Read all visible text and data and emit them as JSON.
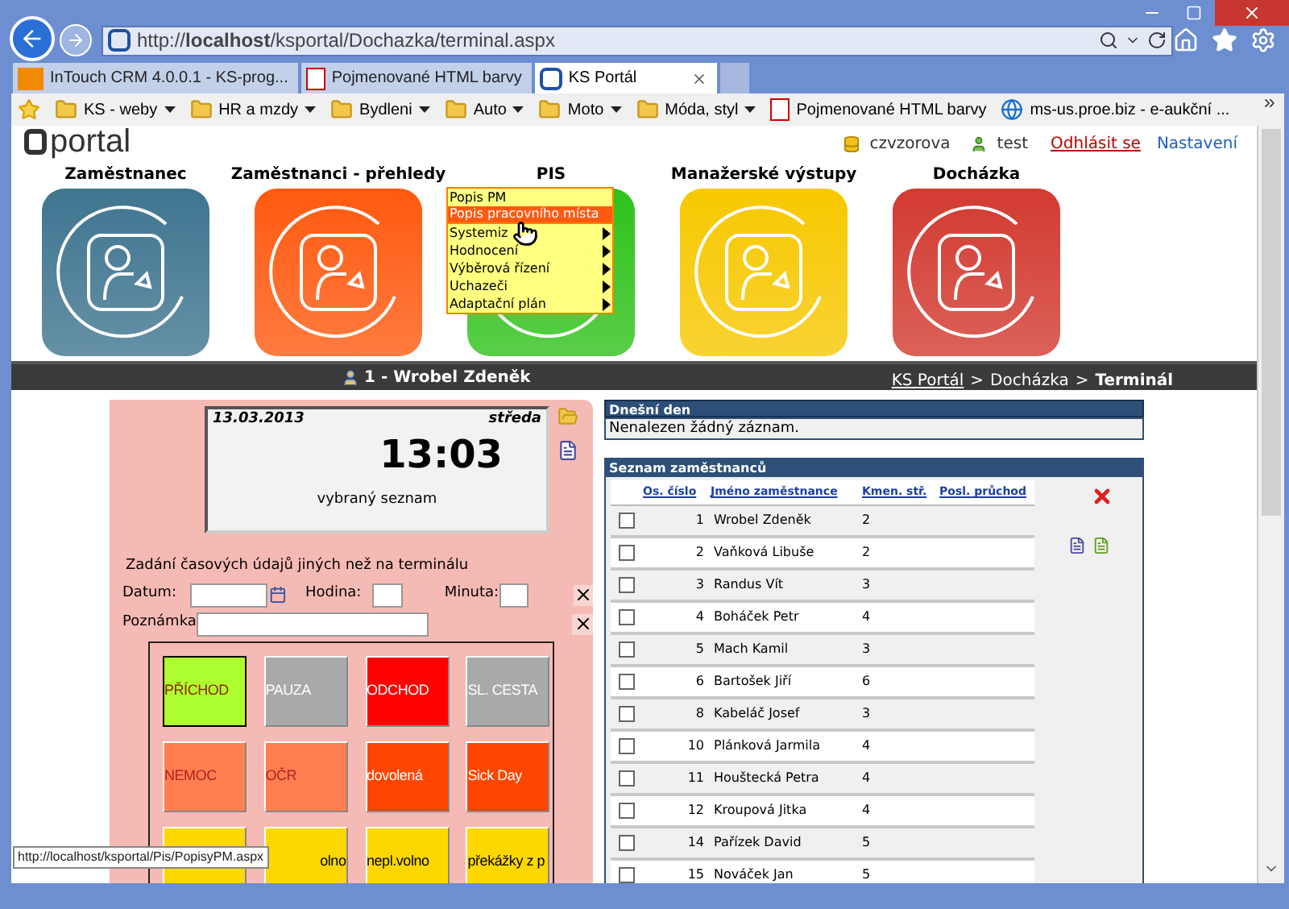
{
  "browser": {
    "url": "http://**localhost**/ksportal/Dochazka/terminal.aspx",
    "tabs": [
      {
        "label": "InTouch CRM 4.0.0.1 - KS-prog...",
        "selected": false,
        "kind": "crm"
      },
      {
        "label": "Pojmenované HTML barvy",
        "selected": false,
        "kind": "page"
      },
      {
        "label": "KS Portál",
        "selected": true,
        "kind": "ks"
      }
    ],
    "favorites": [
      {
        "label": "KS - weby",
        "kind": "folder"
      },
      {
        "label": "HR a mzdy",
        "kind": "folder"
      },
      {
        "label": "Bydleni",
        "kind": "folder"
      },
      {
        "label": "Auto",
        "kind": "folder"
      },
      {
        "label": "Moto",
        "kind": "folder"
      },
      {
        "label": "Móda, styl",
        "kind": "folder"
      },
      {
        "label": "Pojmenované HTML barvy",
        "kind": "page"
      },
      {
        "label": "ms-us.proe.biz - e-aukční ...",
        "kind": "web"
      }
    ],
    "status_url": "http://localhost/ksportal/Pis/PopisyPM.aspx"
  },
  "header": {
    "logo": "portal",
    "user": "czvzorova",
    "role": "test",
    "logout": "Odhlásit se",
    "settings": "Nastavení"
  },
  "tiles": [
    {
      "label": "Zaměstnanec",
      "color": "#3f7590"
    },
    {
      "label": "Zaměstnanci - přehledy",
      "color": "#ff5a10"
    },
    {
      "label": "PIS",
      "color": "#2fc21a"
    },
    {
      "label": "Manažerské výstupy",
      "color": "#f7c800"
    },
    {
      "label": "Docházka",
      "color": "#d23a30"
    }
  ],
  "pis_menu": [
    {
      "label": "Popis PM",
      "submenu": false,
      "selected": false
    },
    {
      "label": "Popis pracovního místa",
      "submenu": false,
      "selected": true
    },
    {
      "label": "Systemiz",
      "submenu": true,
      "selected": false
    },
    {
      "label": "Hodnocení",
      "submenu": true,
      "selected": false
    },
    {
      "label": "Výběrová řízení",
      "submenu": true,
      "selected": false
    },
    {
      "label": "Uchazeči",
      "submenu": true,
      "selected": false
    },
    {
      "label": "Adaptační plán",
      "submenu": true,
      "selected": false
    }
  ],
  "bar": {
    "user": "1 - Wrobel Zdeněk",
    "separator": ">",
    "crumbs": [
      {
        "label": "KS Portál",
        "kind": "link"
      },
      {
        "label": "Docházka",
        "kind": "text"
      },
      {
        "label": "Terminál",
        "kind": "current"
      }
    ]
  },
  "terminal": {
    "date": "13.03.2013",
    "day": "středa",
    "time": "13:03",
    "list": "vybraný seznam",
    "form_title": "Zadání časových údajů jiných než na terminálu",
    "date_label": "Datum:",
    "hour_label": "Hodina:",
    "minute_label": "Minuta:",
    "note_label": "Poznámka",
    "buttons": [
      {
        "label": "PŘÍCHOD",
        "color": "#adff2f",
        "kind": "brown",
        "selected": true
      },
      {
        "label": "PAUZA",
        "color": "#a9a9a9",
        "kind": "light",
        "selected": false
      },
      {
        "label": "ODCHOD",
        "color": "#ff0000",
        "kind": "light",
        "selected": false
      },
      {
        "label": "SL. CESTA",
        "color": "#a9a9a9",
        "kind": "light",
        "selected": false
      },
      {
        "label": "NEMOC",
        "color": "#ff7f50",
        "kind": "red",
        "selected": false
      },
      {
        "label": "OČR",
        "color": "#ff7f50",
        "kind": "red",
        "selected": false
      },
      {
        "label": "dovolená",
        "color": "#ff4500",
        "kind": "light",
        "selected": false
      },
      {
        "label": "Sick Day",
        "color": "#ff4500",
        "kind": "light",
        "selected": false
      },
      {
        "color": "#ffd700",
        "kind": "dark",
        "selected": false
      },
      {
        "label": "olno",
        "color": "#ffd700",
        "kind": "tail",
        "selected": false
      },
      {
        "label": "nepl.volno",
        "color": "#ffd700",
        "kind": "dark",
        "selected": false
      },
      {
        "label": "překážky z p",
        "color": "#ffd700",
        "kind": "dark",
        "selected": false
      }
    ]
  },
  "today": {
    "title": "Dnešní den",
    "message": "Nenalezen žádný záznam."
  },
  "employees": {
    "title": "Seznam zaměstnanců",
    "columns": [
      "Os. číslo",
      "Jméno zaměstnance",
      "Kmen. stř.",
      "Posl. průchod"
    ],
    "rows": [
      {
        "id": "1",
        "name": "Wrobel Zdeněk",
        "dept": "2",
        "checked": false
      },
      {
        "id": "2",
        "name": "Vaňková Libuše",
        "dept": "2",
        "checked": false
      },
      {
        "id": "3",
        "name": "Randus Vít",
        "dept": "3",
        "checked": false
      },
      {
        "id": "4",
        "name": "Boháček Petr",
        "dept": "4",
        "checked": false
      },
      {
        "id": "5",
        "name": "Mach Kamil",
        "dept": "3",
        "checked": false
      },
      {
        "id": "6",
        "name": "Bartošek Jiří",
        "dept": "6",
        "checked": false
      },
      {
        "id": "8",
        "name": "Kabeláč Josef",
        "dept": "3",
        "checked": false
      },
      {
        "id": "10",
        "name": "Plánková Jarmila",
        "dept": "4",
        "checked": false
      },
      {
        "id": "11",
        "name": "Houštecká Petra",
        "dept": "4",
        "checked": false
      },
      {
        "id": "12",
        "name": "Kroupová Jitka",
        "dept": "4",
        "checked": false
      },
      {
        "id": "14",
        "name": "Pařízek David",
        "dept": "5",
        "checked": false
      },
      {
        "id": "15",
        "name": "Nováček Jan",
        "dept": "5",
        "checked": false
      }
    ]
  }
}
